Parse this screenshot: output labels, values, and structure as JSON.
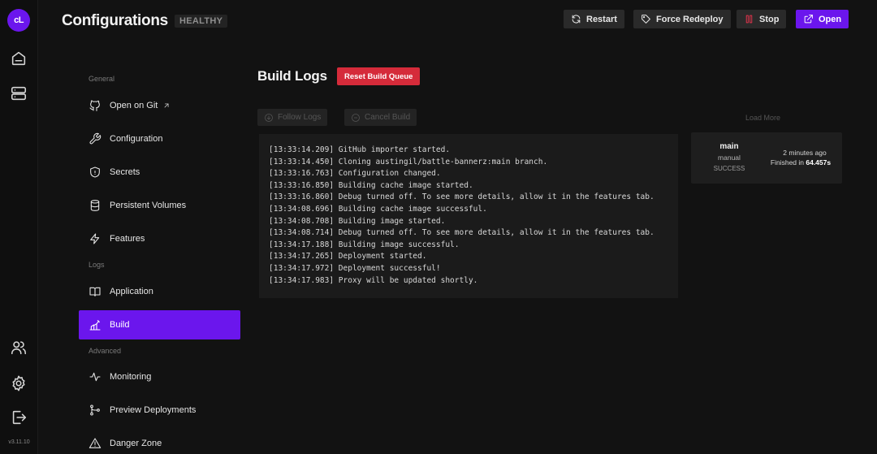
{
  "app": {
    "logo_text": "cL",
    "version": "v3.11.10",
    "brand_color": "#6b16ed"
  },
  "rail": {
    "icons": [
      "home-icon",
      "servers-icon",
      "team-icon",
      "settings-icon",
      "logout-icon"
    ]
  },
  "header": {
    "title": "Configurations",
    "status": "HEALTHY",
    "buttons": {
      "restart": "Restart",
      "force_redeploy": "Force Redeploy",
      "stop": "Stop",
      "open": "Open"
    }
  },
  "nav": {
    "sections": {
      "general": "General",
      "logs": "Logs",
      "advanced": "Advanced"
    },
    "items": {
      "open_on_git": "Open on Git",
      "configuration": "Configuration",
      "secrets": "Secrets",
      "persistent_volumes": "Persistent Volumes",
      "features": "Features",
      "application": "Application",
      "build": "Build",
      "monitoring": "Monitoring",
      "preview_deployments": "Preview Deployments",
      "danger_zone": "Danger Zone"
    },
    "active": "build"
  },
  "build_logs": {
    "title": "Build Logs",
    "reset_label": "Reset Build Queue",
    "follow_label": "Follow Logs",
    "cancel_label": "Cancel Build",
    "lines": [
      "[13:33:14.209] GitHub importer started.",
      "[13:33:14.450] Cloning austingil/battle-bannerz:main branch.",
      "[13:33:16.763] Configuration changed.",
      "[13:33:16.850] Building cache image started.",
      "[13:33:16.860] Debug turned off. To see more details, allow it in the features tab.",
      "[13:34:08.696] Building cache image successful.",
      "[13:34:08.708] Building image started.",
      "[13:34:08.714] Debug turned off. To see more details, allow it in the features tab.",
      "[13:34:17.188] Building image successful.",
      "[13:34:17.265] Deployment started.",
      "[13:34:17.972] Deployment successful!",
      "[13:34:17.983] Proxy will be updated shortly."
    ]
  },
  "deployments": {
    "load_more": "Load More",
    "items": [
      {
        "branch": "main",
        "type": "manual",
        "status": "SUCCESS",
        "time_ago": "2 minutes ago",
        "finished_prefix": "Finished in ",
        "duration": "64.457s"
      }
    ]
  }
}
